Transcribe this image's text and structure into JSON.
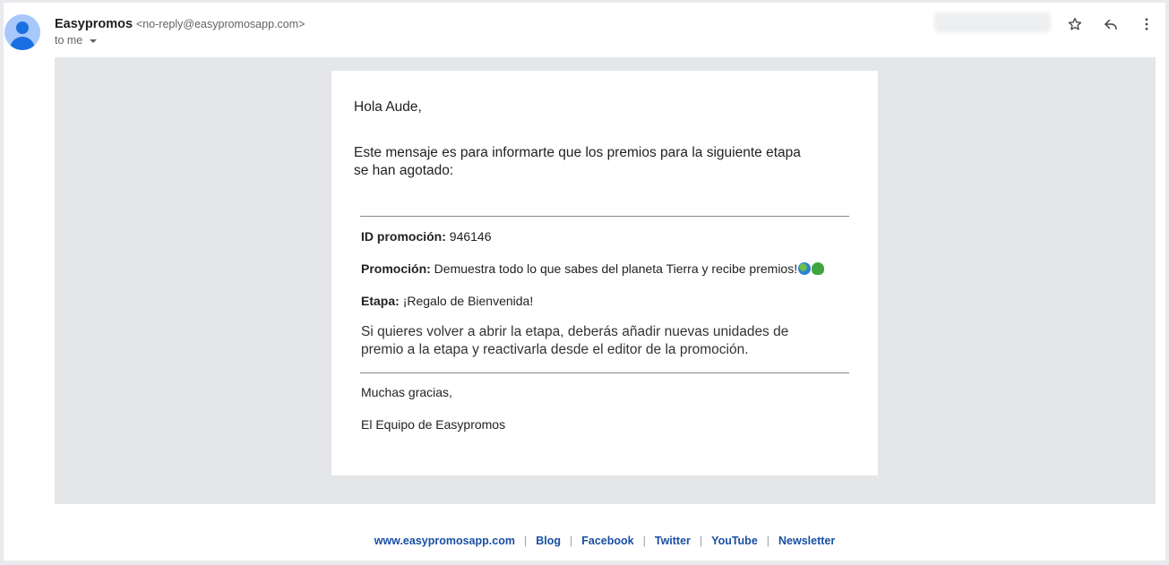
{
  "header": {
    "sender_name": "Easypromos",
    "sender_email": "<no-reply@easypromosapp.com>",
    "recipient_label": "to me",
    "icons": [
      "person-icon",
      "star-icon",
      "reply-icon",
      "more-vert-icon",
      "chevron-down-icon"
    ]
  },
  "body": {
    "greeting": "Hola Aude,",
    "intro_line1": "Este mensaje es para informarte que los premios para la siguiente etapa",
    "intro_line2": "se han agotado:",
    "id_label": "ID promoción:",
    "id_value": "946146",
    "promo_label": "Promoción:",
    "promo_value": "Demuestra todo lo que sabes del planeta Tierra y recibe premios!",
    "stage_label": "Etapa:",
    "stage_value": "¡Regalo de Bienvenida!",
    "note_line1": "Si quieres volver a abrir la etapa, deberás añadir nuevas unidades de",
    "note_line2": "premio a la etapa y reactivarla desde el editor de la promoción.",
    "thanks": "Muchas gracias,",
    "signature": "El Equipo de Easypromos"
  },
  "footer": {
    "links": [
      "www.easypromosapp.com",
      "Blog",
      "Facebook",
      "Twitter",
      "YouTube",
      "Newsletter"
    ],
    "separator": "|"
  },
  "colors": {
    "link": "#1a4fa3",
    "avatar_bg": "#a8c7fa",
    "avatar_fg": "#1a6fe0",
    "email_bg": "#e5e6e8"
  }
}
